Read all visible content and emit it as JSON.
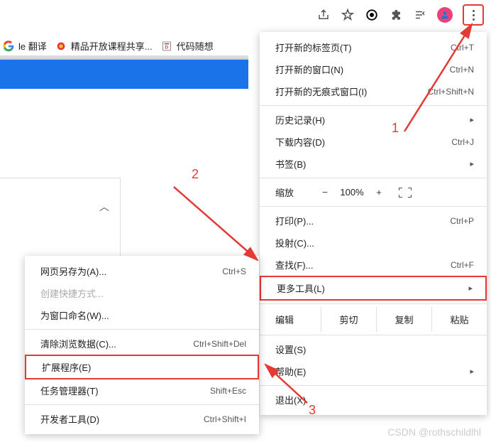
{
  "toolbar": {
    "share": "share-icon",
    "star": "star-icon",
    "circle": "record-icon",
    "ext": "extension-icon",
    "list": "reading-list-icon",
    "avatar": "avatar"
  },
  "bookmarks": {
    "translate": "le 翻译",
    "course": "精品开放课程共享...",
    "code": "代码随想"
  },
  "mainMenu": {
    "newTab": {
      "label": "打开新的标签页(T)",
      "short": "Ctrl+T"
    },
    "newWin": {
      "label": "打开新的窗口(N)",
      "short": "Ctrl+N"
    },
    "newIncog": {
      "label": "打开新的无痕式窗口(I)",
      "short": "Ctrl+Shift+N"
    },
    "history": {
      "label": "历史记录(H)"
    },
    "downloads": {
      "label": "下载内容(D)",
      "short": "Ctrl+J"
    },
    "bookmarks": {
      "label": "书签(B)"
    },
    "zoomLabel": "缩放",
    "zoomMinus": "−",
    "zoomVal": "100%",
    "zoomPlus": "+",
    "print": {
      "label": "打印(P)...",
      "short": "Ctrl+P"
    },
    "cast": {
      "label": "投射(C)..."
    },
    "find": {
      "label": "查找(F)...",
      "short": "Ctrl+F"
    },
    "moreTools": {
      "label": "更多工具(L)"
    },
    "editLabel": "编辑",
    "cut": "剪切",
    "copy": "复制",
    "paste": "粘贴",
    "settings": {
      "label": "设置(S)"
    },
    "help": {
      "label": "帮助(E)"
    },
    "exit": {
      "label": "退出(X)"
    }
  },
  "subMenu": {
    "saveAs": {
      "label": "网页另存为(A)...",
      "short": "Ctrl+S"
    },
    "shortcut": {
      "label": "创建快捷方式..."
    },
    "nameWin": {
      "label": "为窗口命名(W)..."
    },
    "clear": {
      "label": "清除浏览数据(C)...",
      "short": "Ctrl+Shift+Del"
    },
    "extensions": {
      "label": "扩展程序(E)"
    },
    "taskmgr": {
      "label": "任务管理器(T)",
      "short": "Shift+Esc"
    },
    "devtools": {
      "label": "开发者工具(D)",
      "short": "Ctrl+Shift+I"
    }
  },
  "anno": {
    "n1": "1",
    "n2": "2",
    "n3": "3"
  },
  "watermark": "CSDN @rothschildlhl"
}
